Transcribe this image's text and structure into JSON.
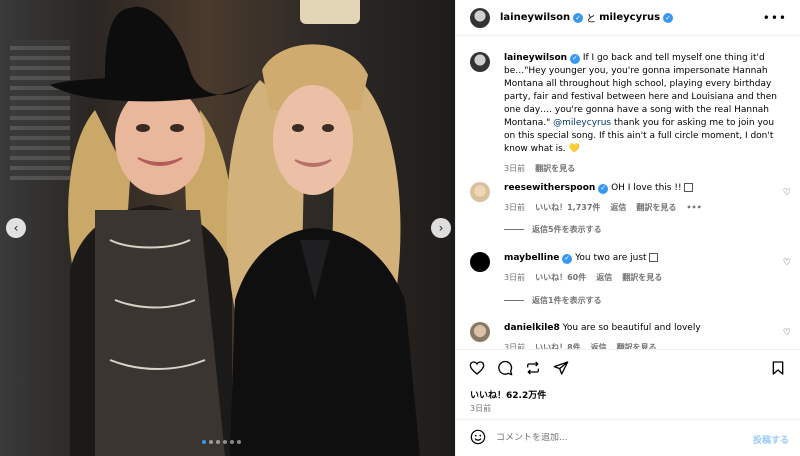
{
  "header": {
    "user1": "laineywilson",
    "conjunction": "と",
    "user2": "mileycyrus"
  },
  "caption": {
    "username": "laineywilson",
    "text_before_mention": "If I go back and tell myself one thing it'd be…\"Hey younger you, you're gonna impersonate Hannah Montana all throughout high school, playing every birthday party, fair and festival between here and Louisiana and then one day…. you're gonna have a song with the real Hannah Montana.\"",
    "mention": "@mileycyrus",
    "text_after_mention": "thank you for asking me to join you on this special song. If this ain't a full circle moment, I don't know what is. 💛",
    "time": "3日前",
    "see_translation": "翻訳を見る"
  },
  "comments": [
    {
      "username": "reesewitherspoon",
      "text": "OH I love this !!",
      "time": "3日前",
      "likes": "いいね！1,737件",
      "reply": "返信",
      "see_translation": "翻訳を見る",
      "more": "•••",
      "view_replies": "返信5件を表示する"
    },
    {
      "username": "maybelline",
      "text": "You two are just",
      "time": "3日前",
      "likes": "いいね！60件",
      "reply": "返信",
      "see_translation": "翻訳を見る",
      "view_replies": "返信1件を表示する"
    },
    {
      "username": "danielkile8",
      "text": "You are so beautiful and lovely",
      "time": "3日前",
      "likes": "いいね！8件",
      "reply": "返信",
      "see_translation": "翻訳を見る"
    }
  ],
  "stats": {
    "likes": "いいね！62.2万件",
    "date": "3日前"
  },
  "composer": {
    "placeholder": "コメントを追加...",
    "post_label": "投稿する"
  },
  "carousel": {
    "slide_count": 6,
    "current_slide": 1
  },
  "colors": {
    "verified": "#3897f0",
    "link": "#00376b",
    "muted": "#737373",
    "post_button": "#9ccaf7"
  }
}
